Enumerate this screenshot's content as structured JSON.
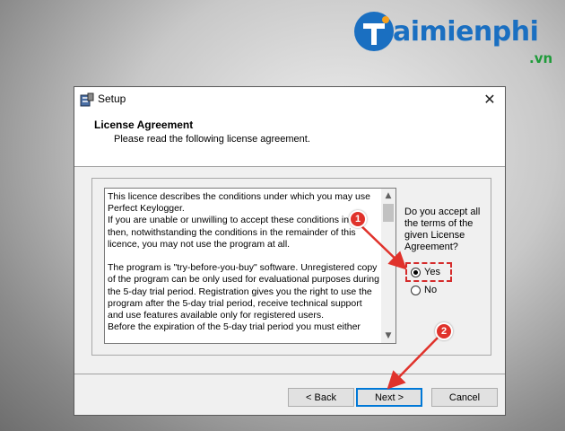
{
  "watermark": {
    "brand": "aimienphi",
    "sub": ".vn"
  },
  "window": {
    "title": "Setup",
    "close_glyph": "✕"
  },
  "header": {
    "title": "License Agreement",
    "subtitle": "Please read the following license agreement."
  },
  "license": {
    "text": "This licence describes the conditions under which you may use Perfect Keylogger.\nIf you are unable or unwilling to accept these conditions in full, then, notwithstanding the conditions in the remainder of this licence, you may not use the program at all.\n\nThe program is \"try-before-you-buy\" software. Unregistered copy of the program can be only used for evaluational purposes during the 5-day trial period. Registration gives you the right to use the program after the 5-day trial period, receive technical support and use features available only for registered users.\nBefore the expiration of the 5-day trial period you must either"
  },
  "question": "Do you accept all the terms of the given License Agreement?",
  "options": [
    {
      "label": "Yes",
      "selected": true
    },
    {
      "label": "No",
      "selected": false
    }
  ],
  "buttons": {
    "back": "< Back",
    "next": "Next >",
    "cancel": "Cancel"
  },
  "annotations": {
    "step1": "1",
    "step2": "2"
  },
  "colors": {
    "annotation": "#e0322b",
    "focus": "#0078d7",
    "brand_blue": "#1a6fc1",
    "brand_green": "#1f9b3a"
  }
}
